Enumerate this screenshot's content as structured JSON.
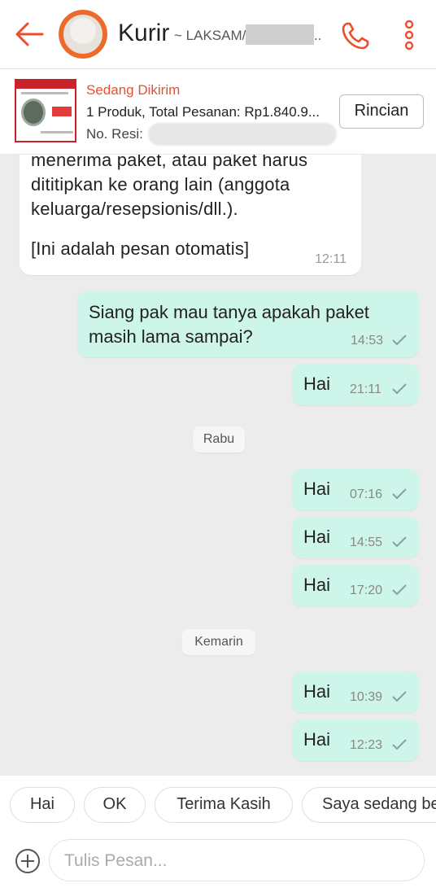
{
  "header": {
    "title": "Kurir",
    "subtitle": "~ LAKSAM/",
    "subtitle_ellipsis": "..",
    "icons": {
      "back": "back-arrow-icon",
      "phone": "phone-icon",
      "more": "more-vertical-icon"
    }
  },
  "order": {
    "status": "Sedang Dikirim",
    "summary": "1 Produk, Total Pesanan: Rp1.840.9...",
    "resi_label": "No. Resi:",
    "details_button": "Rincian"
  },
  "chat": {
    "incoming": {
      "lines": [
        "menerima paket, atau paket harus",
        "dititipkan ke orang lain (anggota",
        "keluarga/resepsionis/dll.).",
        "",
        "[Ini adalah pesan otomatis]"
      ],
      "time": "12:11"
    },
    "outgoing_1": {
      "lines": [
        "Siang pak mau tanya apakah paket",
        "masih lama sampai?"
      ],
      "time": "14:53"
    },
    "outgoing_2": {
      "text": "Hai",
      "time": "21:11"
    },
    "date_1": "Rabu",
    "outgoing_3": {
      "text": "Hai",
      "time": "07:16"
    },
    "outgoing_4": {
      "text": "Hai",
      "time": "14:55"
    },
    "outgoing_5": {
      "text": "Hai",
      "time": "17:20"
    },
    "date_2": "Kemarin",
    "outgoing_6": {
      "text": "Hai",
      "time": "10:39"
    },
    "outgoing_7": {
      "text": "Hai",
      "time": "12:23"
    }
  },
  "quick_replies": [
    "Hai",
    "OK",
    "Terima Kasih",
    "Saya sedang be"
  ],
  "input": {
    "placeholder": "Tulis Pesan..."
  },
  "colors": {
    "accent": "#ee4d2d",
    "outgoing_bubble": "#cdf5ea",
    "background": "#ececec"
  }
}
